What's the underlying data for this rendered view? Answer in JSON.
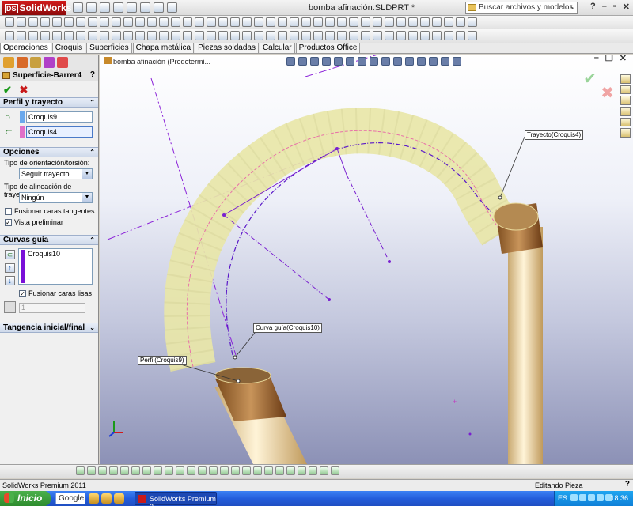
{
  "app": {
    "logo_text": "SolidWorks",
    "logo_mark": "DS",
    "doc_title": "bomba afinación.SLDPRT *",
    "search_placeholder": "Buscar archivos y modelos"
  },
  "tabs": [
    "Operaciones",
    "Croquis",
    "Superficies",
    "Chapa metálica",
    "Piezas soldadas",
    "Calcular",
    "Productos Office"
  ],
  "active_tab": "Operaciones",
  "property_manager": {
    "title": "Superficie-Barrer4",
    "help": "?",
    "sections": {
      "perfil": {
        "header": "Perfil y trayecto",
        "profile_value": "Croquis9",
        "path_value": "Croquis4",
        "profile_color": "#6aa8ec",
        "path_color": "#e070c8"
      },
      "opciones": {
        "header": "Opciones",
        "orientation_label": "Tipo de orientación/torsión:",
        "orientation_value": "Seguir trayecto",
        "alignment_label": "Tipo de alineación de trayecto:",
        "alignment_value": "Ningún",
        "merge_tangent_label": "Fusionar caras tangentes",
        "merge_tangent_checked": false,
        "preview_label": "Vista preliminar",
        "preview_checked": true
      },
      "curvas": {
        "header": "Curvas guía",
        "items": [
          "Croquis10"
        ],
        "item_color": "#7a10d8",
        "merge_smooth_label": "Fusionar caras lisas",
        "merge_smooth_checked": true,
        "count_value": "1"
      },
      "tangencia": {
        "header": "Tangencia inicial/final"
      }
    }
  },
  "viewport": {
    "tree_label": "bomba afinación  (Predetermi...",
    "callouts": {
      "trayecto": "Trayecto(Croquis4)",
      "curva_guia": "Curva guía(Croquis10)",
      "perfil": "Perfil(Croquis9)"
    },
    "colors": {
      "tube": "#e8e6a8",
      "ring": "#a4743a",
      "rod": "#eedcac",
      "sketch": "#8a20d8",
      "path_line": "#e870a8"
    }
  },
  "status": {
    "left": "SolidWorks Premium 2011",
    "right": "Editando Pieza",
    "help": "?"
  },
  "taskbar": {
    "start": "Inicio",
    "google": "Google",
    "task_item": "SolidWorks Premium 2...",
    "lang": "ES",
    "clock": "18:36"
  }
}
